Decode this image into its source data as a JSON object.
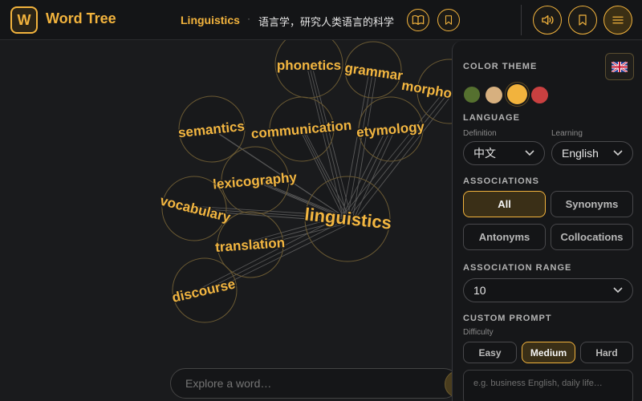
{
  "app": {
    "logo_letter": "W",
    "title": "Word Tree"
  },
  "header": {
    "word": "Linguistics",
    "separator": "·",
    "definition": "语言学，研究人类语言的科学",
    "icons": [
      "book-icon",
      "bookmark-icon",
      "volume-icon",
      "bookmark-icon",
      "menu-icon"
    ]
  },
  "graph": {
    "center": "linguistics",
    "nodes": [
      {
        "id": "phonetics",
        "label": "phonetics"
      },
      {
        "id": "grammar",
        "label": "grammar"
      },
      {
        "id": "morphology",
        "label": "morphology"
      },
      {
        "id": "semantics",
        "label": "semantics"
      },
      {
        "id": "communication",
        "label": "communication"
      },
      {
        "id": "etymology",
        "label": "etymology"
      },
      {
        "id": "lexicography",
        "label": "lexicography"
      },
      {
        "id": "vocabulary",
        "label": "vocabulary"
      },
      {
        "id": "linguistics",
        "label": "linguistics"
      },
      {
        "id": "translation",
        "label": "translation"
      },
      {
        "id": "discourse",
        "label": "discourse"
      }
    ]
  },
  "search": {
    "placeholder": "Explore a word…"
  },
  "settings": {
    "color_theme": {
      "title": "COLOR THEME",
      "flag": "uk-flag-icon",
      "swatches": [
        "#55702f",
        "#d7b07f",
        "#f2b33d",
        "#c94040"
      ],
      "selected": "#f2b33d"
    },
    "language": {
      "title": "LANGUAGE",
      "definition_label": "Definition",
      "definition_value": "中文",
      "learning_label": "Learning",
      "learning_value": "English"
    },
    "associations": {
      "title": "ASSOCIATIONS",
      "options": [
        "All",
        "Synonyms",
        "Antonyms",
        "Collocations"
      ],
      "selected": "All"
    },
    "association_range": {
      "title": "ASSOCIATION RANGE",
      "value": "10"
    },
    "custom_prompt": {
      "title": "CUSTOM PROMPT",
      "difficulty_label": "Difficulty",
      "difficulties": [
        "Easy",
        "Medium",
        "Hard"
      ],
      "selected": "Medium",
      "placeholder": "e.g. business English, daily life…"
    }
  }
}
